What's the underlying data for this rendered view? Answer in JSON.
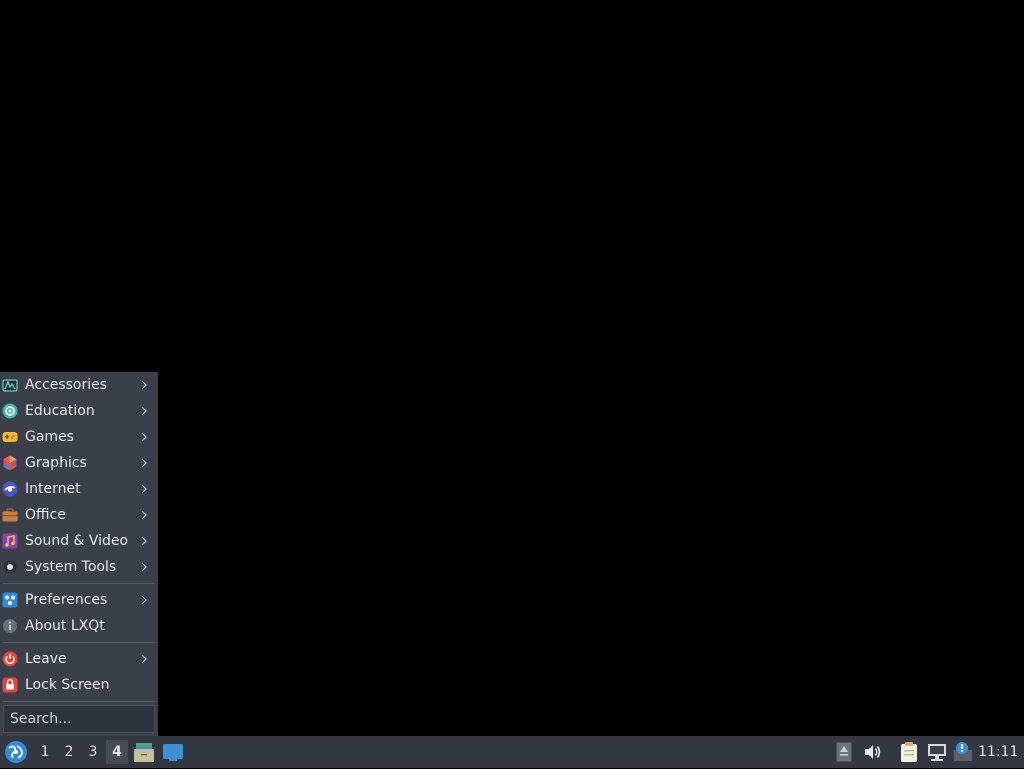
{
  "menu": {
    "categories": [
      {
        "label": "Accessories",
        "icon": "accessories-icon",
        "submenu": true
      },
      {
        "label": "Education",
        "icon": "education-icon",
        "submenu": true
      },
      {
        "label": "Games",
        "icon": "games-icon",
        "submenu": true
      },
      {
        "label": "Graphics",
        "icon": "graphics-icon",
        "submenu": true
      },
      {
        "label": "Internet",
        "icon": "internet-icon",
        "submenu": true
      },
      {
        "label": "Office",
        "icon": "office-icon",
        "submenu": true
      },
      {
        "label": "Sound & Video",
        "icon": "sound-video-icon",
        "submenu": true
      },
      {
        "label": "System Tools",
        "icon": "system-tools-icon",
        "submenu": true
      }
    ],
    "settings": [
      {
        "label": "Preferences",
        "icon": "preferences-icon",
        "submenu": true
      },
      {
        "label": "About LXQt",
        "icon": "info-icon",
        "submenu": false
      }
    ],
    "session": [
      {
        "label": "Leave",
        "icon": "power-icon",
        "submenu": true
      },
      {
        "label": "Lock Screen",
        "icon": "lock-icon",
        "submenu": false
      }
    ],
    "search": {
      "placeholder": "Search..."
    }
  },
  "taskbar": {
    "workspaces": [
      {
        "label": "1",
        "active": false
      },
      {
        "label": "2",
        "active": false
      },
      {
        "label": "3",
        "active": false
      },
      {
        "label": "4",
        "active": true
      }
    ],
    "quicklaunch": [
      "file-manager-icon",
      "show-desktop-icon"
    ],
    "tray": [
      "eject-icon",
      "volume-icon",
      "clipboard-icon",
      "network-icon",
      "update-notifier-icon"
    ],
    "clock": "11:11"
  },
  "colors": {
    "menu_bg": "#3a3f4a",
    "taskbar_bg": "#323742",
    "text": "#e8eaee",
    "desktop_bg": "#000000"
  }
}
